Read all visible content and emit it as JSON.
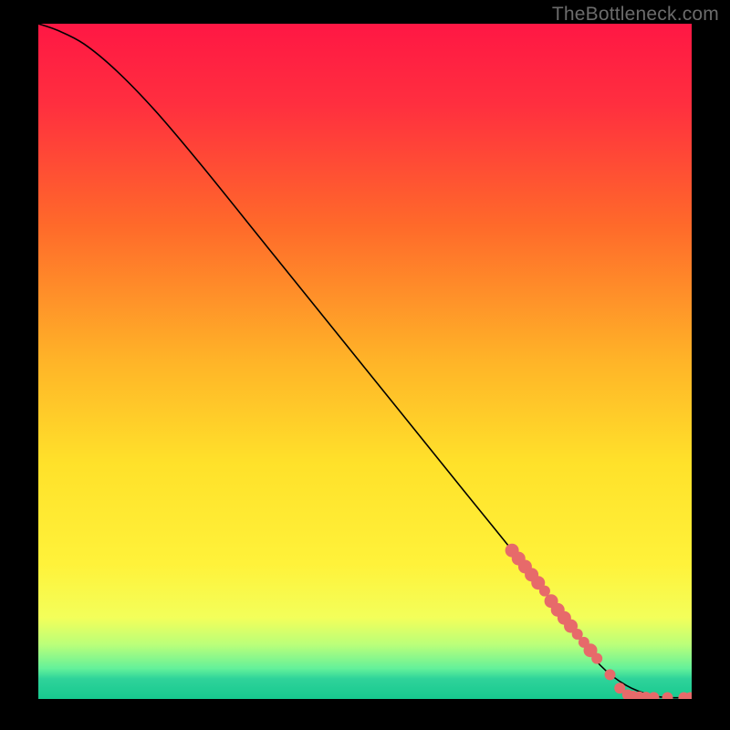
{
  "watermark": "TheBottleneck.com",
  "chart_data": {
    "type": "line",
    "title": "",
    "xlabel": "",
    "ylabel": "",
    "xlim": [
      0,
      100
    ],
    "ylim": [
      0,
      100
    ],
    "grid": false,
    "legend": false,
    "background_gradient": [
      {
        "stop": 0.0,
        "color": "#ff1744"
      },
      {
        "stop": 0.12,
        "color": "#ff2f3f"
      },
      {
        "stop": 0.3,
        "color": "#ff6a2a"
      },
      {
        "stop": 0.5,
        "color": "#ffb428"
      },
      {
        "stop": 0.65,
        "color": "#ffe12a"
      },
      {
        "stop": 0.8,
        "color": "#fff23a"
      },
      {
        "stop": 0.88,
        "color": "#f3ff5a"
      },
      {
        "stop": 0.92,
        "color": "#b9ff7a"
      },
      {
        "stop": 0.955,
        "color": "#63f19a"
      },
      {
        "stop": 0.97,
        "color": "#2fd39a"
      },
      {
        "stop": 1.0,
        "color": "#17c98f"
      }
    ],
    "series": [
      {
        "name": "curve",
        "x": [
          0,
          3,
          7,
          12,
          18,
          25,
          35,
          45,
          55,
          65,
          75,
          82,
          86,
          90,
          94,
          97,
          100
        ],
        "values": [
          100,
          99,
          97,
          93,
          87,
          79,
          67,
          55,
          43,
          31,
          19,
          10,
          5,
          2,
          0.5,
          0.2,
          0.2
        ]
      }
    ],
    "scatter": {
      "name": "points",
      "color": "#e76a6a",
      "points": [
        {
          "x": 72.5,
          "y": 22.0,
          "big": true
        },
        {
          "x": 73.5,
          "y": 20.8,
          "big": true
        },
        {
          "x": 74.5,
          "y": 19.6,
          "big": true
        },
        {
          "x": 75.5,
          "y": 18.4,
          "big": true
        },
        {
          "x": 76.5,
          "y": 17.2,
          "big": true
        },
        {
          "x": 77.5,
          "y": 16.0,
          "big": false
        },
        {
          "x": 78.5,
          "y": 14.5,
          "big": true
        },
        {
          "x": 79.5,
          "y": 13.2,
          "big": true
        },
        {
          "x": 80.5,
          "y": 12.0,
          "big": true
        },
        {
          "x": 81.5,
          "y": 10.8,
          "big": true
        },
        {
          "x": 82.5,
          "y": 9.6,
          "big": false
        },
        {
          "x": 83.5,
          "y": 8.4,
          "big": false
        },
        {
          "x": 84.5,
          "y": 7.2,
          "big": true
        },
        {
          "x": 85.5,
          "y": 6.0,
          "big": false
        },
        {
          "x": 87.5,
          "y": 3.6,
          "big": false
        },
        {
          "x": 89.0,
          "y": 1.6,
          "big": false
        },
        {
          "x": 90.2,
          "y": 0.6,
          "big": false
        },
        {
          "x": 91.0,
          "y": 0.4,
          "big": false
        },
        {
          "x": 92.0,
          "y": 0.3,
          "big": false
        },
        {
          "x": 93.0,
          "y": 0.25,
          "big": false
        },
        {
          "x": 94.2,
          "y": 0.22,
          "big": false
        },
        {
          "x": 96.3,
          "y": 0.2,
          "big": false
        },
        {
          "x": 98.8,
          "y": 0.2,
          "big": false
        },
        {
          "x": 99.8,
          "y": 0.2,
          "big": false
        }
      ]
    }
  }
}
